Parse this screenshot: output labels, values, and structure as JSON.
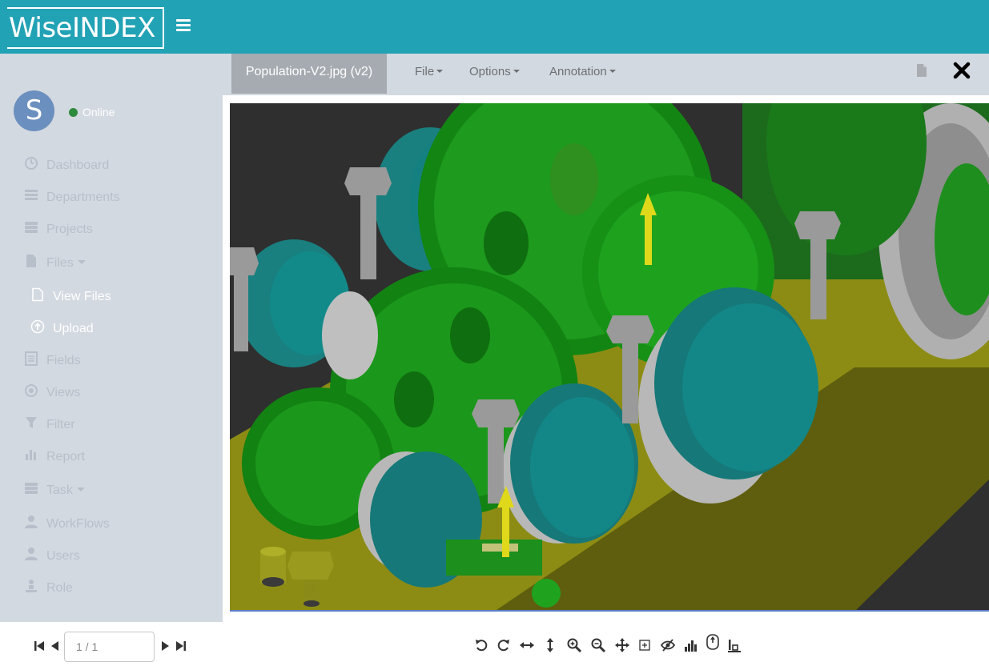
{
  "app": {
    "logo_text": "WiseINDEX",
    "brand_color": "#22a2b5"
  },
  "user": {
    "avatar_letter": "S",
    "status_text": "Online",
    "status_color": "#2e8b3e"
  },
  "sidebar": {
    "items": [
      {
        "label": "Dashboard",
        "icon": "dashboard-icon"
      },
      {
        "label": "Departments",
        "icon": "list-icon"
      },
      {
        "label": "Projects",
        "icon": "stack-icon"
      },
      {
        "label": "Files",
        "icon": "file-icon",
        "expanded": true
      },
      {
        "label": "View Files",
        "icon": "file-outline-icon",
        "sub": true
      },
      {
        "label": "Upload",
        "icon": "upload-icon",
        "sub": true
      },
      {
        "label": "Fields",
        "icon": "form-icon"
      },
      {
        "label": "Views",
        "icon": "view-icon"
      },
      {
        "label": "Filter",
        "icon": "filter-icon"
      },
      {
        "label": "Report",
        "icon": "bar-chart-icon"
      },
      {
        "label": "Task",
        "icon": "tasks-icon",
        "expanded": false
      },
      {
        "label": "WorkFlows",
        "icon": "user-icon"
      },
      {
        "label": "Users",
        "icon": "user-icon"
      },
      {
        "label": "Role",
        "icon": "role-icon"
      }
    ]
  },
  "viewer": {
    "file_tab": "Population-V2.jpg (v2)",
    "menus": [
      "File",
      "Options",
      "Annotation"
    ],
    "header_icons": [
      "document-icon",
      "close-icon"
    ]
  },
  "pager": {
    "value": "1 / 1"
  },
  "toolbar": {
    "tools": [
      "rotate-left-icon",
      "rotate-right-icon",
      "fit-width-icon",
      "fit-height-icon",
      "zoom-in-icon",
      "zoom-out-icon",
      "pan-icon",
      "zoom-rect-icon",
      "hide-annotations-icon",
      "histogram-icon",
      "select-icon",
      "baseline-icon"
    ]
  }
}
